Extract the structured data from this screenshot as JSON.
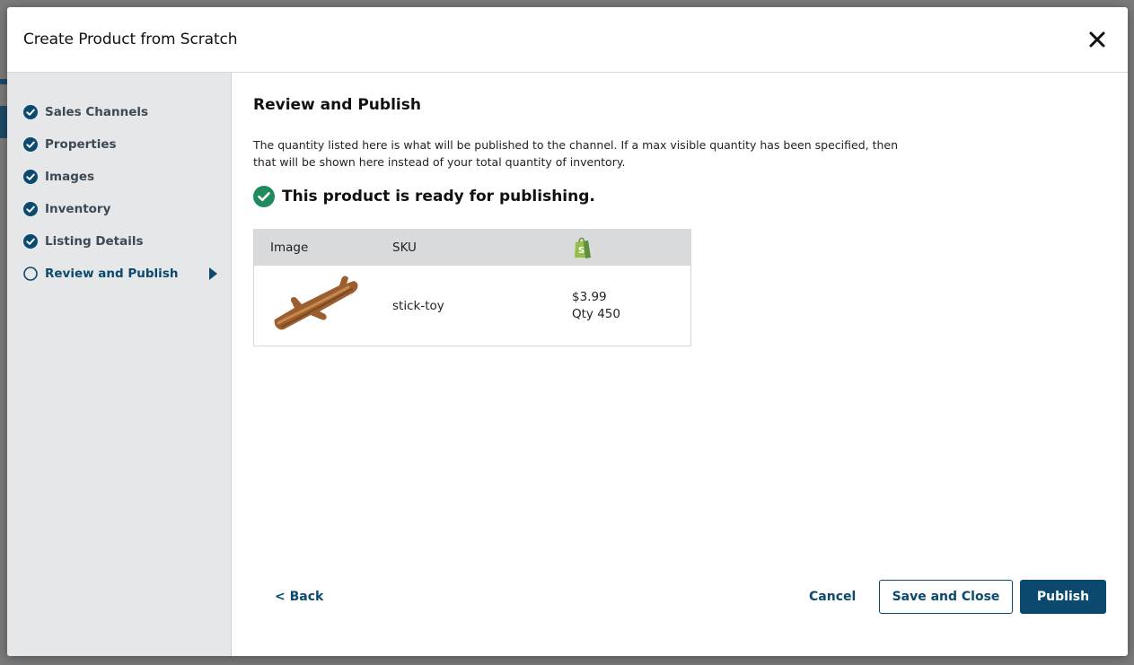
{
  "modal": {
    "title": "Create Product from Scratch"
  },
  "sidebar": {
    "steps": [
      {
        "label": "Sales Channels",
        "status": "complete"
      },
      {
        "label": "Properties",
        "status": "complete"
      },
      {
        "label": "Images",
        "status": "complete"
      },
      {
        "label": "Inventory",
        "status": "complete"
      },
      {
        "label": "Listing Details",
        "status": "complete"
      },
      {
        "label": "Review and Publish",
        "status": "current"
      }
    ]
  },
  "main": {
    "title": "Review and Publish",
    "description": "The quantity listed here is what will be published to the channel. If a max visible quantity has been specified, then that will be shown here instead of your total quantity of inventory.",
    "ready_message": "This product is ready for publishing.",
    "table": {
      "headers": {
        "image": "Image",
        "sku": "SKU",
        "channel_icon": "shopify-icon"
      },
      "rows": [
        {
          "image_icon": "stick-toy-image",
          "sku": "stick-toy",
          "price": "$3.99",
          "qty": "Qty 450"
        }
      ]
    }
  },
  "footer": {
    "back_label": "< Back",
    "cancel_label": "Cancel",
    "save_close_label": "Save and Close",
    "publish_label": "Publish"
  },
  "colors": {
    "primary": "#0b4a6e",
    "success": "#1f8a5b",
    "sidebar_bg": "#e6e7e9",
    "table_header_bg": "#d9dadc",
    "shopify_green": "#95bf47"
  }
}
